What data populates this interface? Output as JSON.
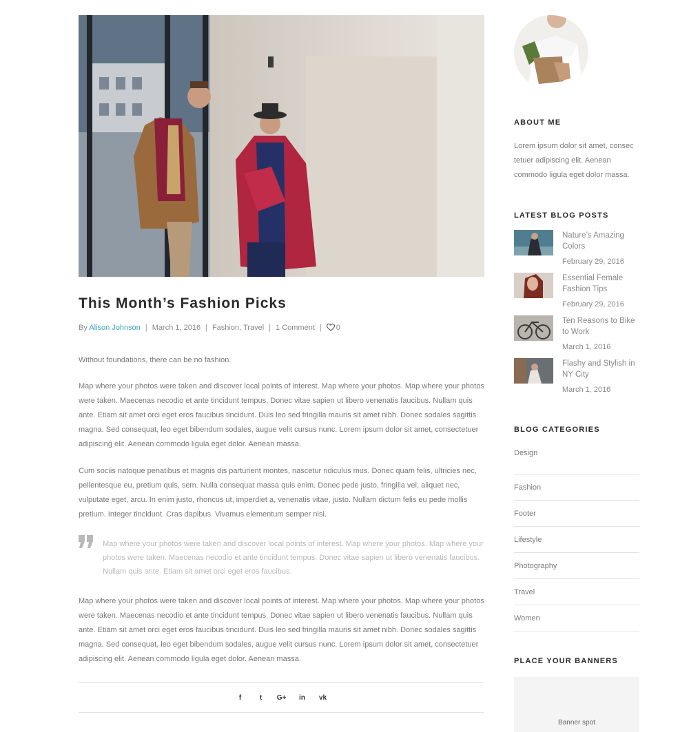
{
  "post": {
    "title": "This Month’s Fashion Picks",
    "meta": {
      "by": "By ",
      "author": "Alison Johnson",
      "date": "March 1, 2016",
      "categories": "Fashion, Travel",
      "comments": "1 Comment",
      "likes": "0"
    },
    "intro": "Without foundations, there can be no fashion.",
    "paragraph1": "Map where your photos were taken and discover local points of interest. Map where your photos. Map where your photos were taken. Maecenas necodio et ante tincidunt tempus. Donec vitae sapien ut libero venenatis faucibus. Nullam quis ante. Etiam sit amet orci eget eros faucibus tincidunt. Duis leo sed fringilla mauris sit amet nibh. Donec sodales sagittis magna. Sed consequat, leo eget bibendum sodales, augue velit cursus nunc. Lorem ipsum dolor sit amet, consectetuer adipiscing elit. Aenean commodo ligula eget dolor. Aenean massa.",
    "paragraph2": "Cum sociis natoque penatibus et magnis dis parturient montes, nascetur ridiculus mus. Donec quam felis, ultricies nec, pellentesque eu, pretium quis, sem. Nulla consequat massa quis enim. Donec pede justo, fringilla vel, aliquet nec, vulputate eget, arcu. In enim justo, rhoncus ut, imperdiet a, venenatis vitae, justo. Nullam dictum felis eu pede mollis pretium. Integer tincidunt. Cras dapibus. Vivamus elementum semper nisi.",
    "quote": "Map where your photos were taken and discover local points of interest. Map where your photos. Map where your photos were taken. Maecenas necodio et ante tincidunt tempus. Donec vitae sapien ut libero venenatis faucibus. Nullam quis ante. Etiam sit amet orci eget eros faucibus.",
    "paragraph3": "Map where your photos were taken and discover local points of interest. Map where your photos. Map where your photos were taken. Maecenas necodio et ante tincidunt tempus. Donec vitae sapien ut libero venenatis faucibus. Nullam quis ante. Etiam sit amet orci eget eros faucibus tincidunt. Duis leo sed fringilla mauris sit amet nibh. Donec sodales sagittis magna. Sed consequat, leo eget bibendum sodales, augue velit cursus nunc. Lorem ipsum dolor sit amet, consectetuer adipiscing elit. Aenean commodo ligula eget dolor. Aenean massa.",
    "share": [
      {
        "icon": "facebook-icon",
        "glyph": "f"
      },
      {
        "icon": "twitter-icon",
        "glyph": "t"
      },
      {
        "icon": "google-plus-icon",
        "glyph": "G+"
      },
      {
        "icon": "linkedin-icon",
        "glyph": "in"
      },
      {
        "icon": "vk-icon",
        "glyph": "vk"
      }
    ]
  },
  "sidebar": {
    "about": {
      "title": "ABOUT ME",
      "text": "Lorem ipsum dolor sit amet, consec tetuer adipiscing elit. Aenean commodo ligula eget dolor massa."
    },
    "latest": {
      "title": "LATEST BLOG POSTS",
      "items": [
        {
          "title": "Nature’s Amazing Colors",
          "date": "February 29, 2016"
        },
        {
          "title": "Essential Female Fashion Tips",
          "date": "February 29, 2016"
        },
        {
          "title": "Ten Reasons to Bike to Work",
          "date": "March 1, 2016"
        },
        {
          "title": "Flashy and Stylish in NY City",
          "date": "March 1, 2016"
        }
      ]
    },
    "categories": {
      "title": "BLOG CATEGORIES",
      "items": [
        "Design",
        "Fashion",
        "Footer",
        "Lifestyle",
        "Photography",
        "Travel",
        "Women"
      ]
    },
    "banner": {
      "title": "PLACE YOUR BANNERS",
      "text": "Banner spot"
    }
  },
  "colors": {
    "accent": "#3aa3c4",
    "heading": "#2a2a2a",
    "text": "#787878"
  }
}
